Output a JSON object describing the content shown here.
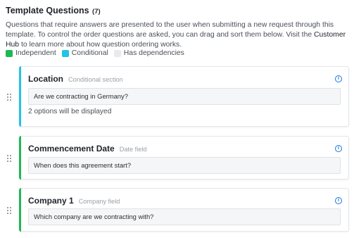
{
  "header": {
    "title": "Template Questions",
    "count": "(7)",
    "description_pre": "Questions that require answers are presented to the user when submitting a new request through this template. To control the order questions are asked, you can drag and sort them below. Visit the ",
    "link_text": "Customer Hub",
    "description_post": " to learn more about how question ordering works."
  },
  "legend": [
    {
      "label": "Independent",
      "color": "#1db954"
    },
    {
      "label": "Conditional",
      "color": "#22c3e6"
    },
    {
      "label": "Has dependencies",
      "color": "#e8eaee"
    }
  ],
  "cards": [
    {
      "title": "Location",
      "type": "Conditional section",
      "question": "Are we contracting in Germany?",
      "note": "2 options will be displayed",
      "accent": "#22c3e6"
    },
    {
      "title": "Commencement Date",
      "type": "Date field",
      "question": "When does this agreement start?",
      "accent": "#1db954"
    },
    {
      "title": "Company 1",
      "type": "Company field",
      "question": "Which company are we contracting with?",
      "accent": "#1db954"
    }
  ],
  "icons": {
    "info": "i"
  }
}
